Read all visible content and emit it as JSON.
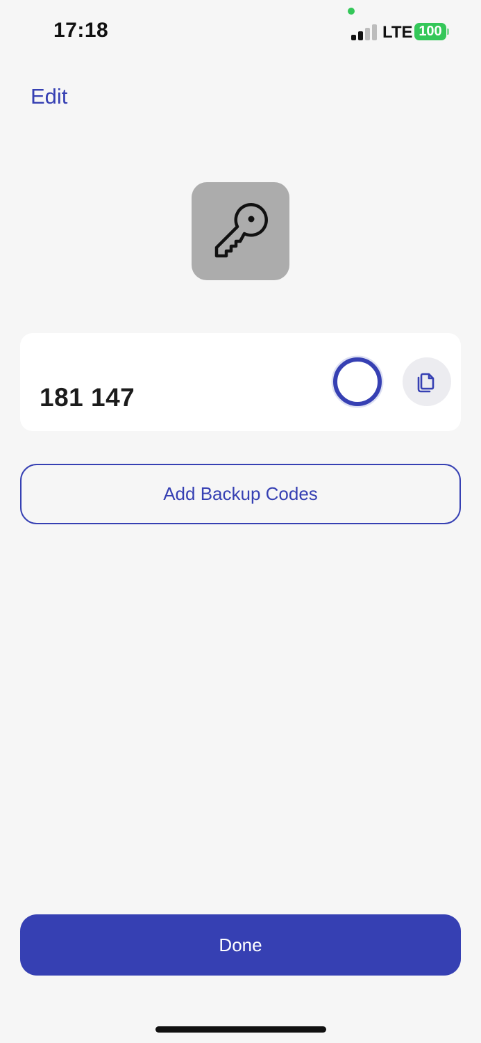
{
  "status_bar": {
    "time": "17:18",
    "network": "LTE",
    "battery": "100",
    "signal_bars_active": 2,
    "signal_bars_total": 4
  },
  "header": {
    "edit_label": "Edit"
  },
  "account": {
    "icon": "key-icon",
    "code": "181 147",
    "timer_remaining_fraction": 1.0,
    "copy_icon": "copy-icon"
  },
  "actions": {
    "add_backup_label": "Add Backup Codes",
    "done_label": "Done"
  },
  "colors": {
    "accent": "#3640b3",
    "background": "#f6f6f6",
    "card": "#ffffff",
    "icon_tile": "#acacac",
    "battery": "#34c759"
  }
}
